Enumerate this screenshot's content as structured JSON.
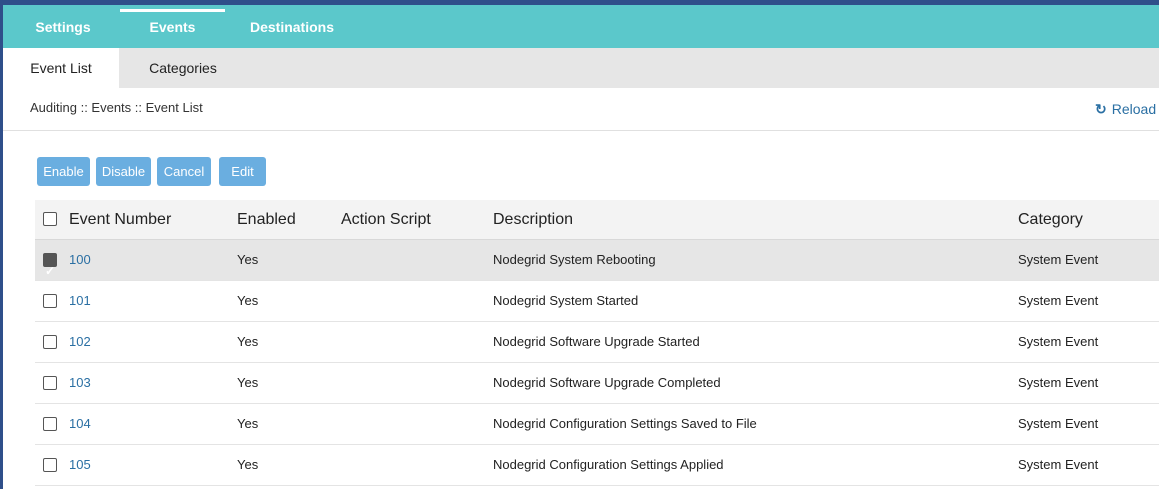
{
  "top_tabs": [
    {
      "label": "Settings",
      "active": false
    },
    {
      "label": "Events",
      "active": true
    },
    {
      "label": "Destinations",
      "active": false
    }
  ],
  "sub_tabs": [
    {
      "label": "Event List",
      "active": true
    },
    {
      "label": "Categories",
      "active": false
    }
  ],
  "breadcrumb": "Auditing :: Events :: Event List",
  "reload": {
    "label": "Reload",
    "icon": "refresh-icon"
  },
  "toolbar": {
    "enable_label": "Enable",
    "disable_label": "Disable",
    "cancel_label": "Cancel",
    "edit_label": "Edit"
  },
  "table": {
    "headers": [
      "Event Number",
      "Enabled",
      "Action Script",
      "Description",
      "Category"
    ],
    "rows": [
      {
        "number": "100",
        "enabled": "Yes",
        "action_script": "",
        "description": "Nodegrid System Rebooting",
        "category": "System Event",
        "checked": true
      },
      {
        "number": "101",
        "enabled": "Yes",
        "action_script": "",
        "description": "Nodegrid System Started",
        "category": "System Event",
        "checked": false
      },
      {
        "number": "102",
        "enabled": "Yes",
        "action_script": "",
        "description": "Nodegrid Software Upgrade Started",
        "category": "System Event",
        "checked": false
      },
      {
        "number": "103",
        "enabled": "Yes",
        "action_script": "",
        "description": "Nodegrid Software Upgrade Completed",
        "category": "System Event",
        "checked": false
      },
      {
        "number": "104",
        "enabled": "Yes",
        "action_script": "",
        "description": "Nodegrid Configuration Settings Saved to File",
        "category": "System Event",
        "checked": false
      },
      {
        "number": "105",
        "enabled": "Yes",
        "action_script": "",
        "description": "Nodegrid Configuration Settings Applied",
        "category": "System Event",
        "checked": false
      }
    ]
  },
  "colors": {
    "top_nav": "#5bc8cb",
    "button": "#6aaee0",
    "link": "#2a6fa3",
    "selected_row": "#e6e6e6"
  }
}
